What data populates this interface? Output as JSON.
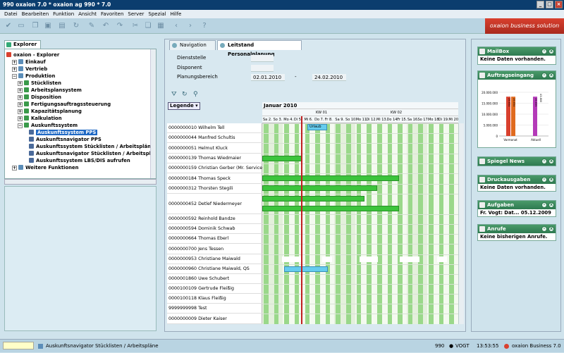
{
  "window": {
    "title": "990 oxaion  7.0 * oxaion ag 990    * 7.0"
  },
  "menu": [
    "Datei",
    "Bearbeiten",
    "Funktion",
    "Ansicht",
    "Favoriten",
    "Server",
    "Spezial",
    "Hilfe"
  ],
  "brand": "oxaion business solution",
  "explorer": {
    "tab": "Explorer",
    "items": [
      {
        "label": "oxaion - Explorer",
        "level": 0
      },
      {
        "label": "Einkauf",
        "level": 1
      },
      {
        "label": "Vertrieb",
        "level": 1
      },
      {
        "label": "Produktion",
        "level": 1
      },
      {
        "label": "Stücklisten",
        "level": 2
      },
      {
        "label": "Arbeitsplansystem",
        "level": 2
      },
      {
        "label": "Disposition",
        "level": 2
      },
      {
        "label": "Fertigungsauftragssteuerung",
        "level": 2
      },
      {
        "label": "Kapazitätsplanung",
        "level": 2
      },
      {
        "label": "Kalkulation",
        "level": 2
      },
      {
        "label": "Auskunftssystem",
        "level": 2
      },
      {
        "label": "Auskunftssystem PPS",
        "level": 3,
        "selected": true
      },
      {
        "label": "Auskunftsnavigator PPS",
        "level": 3
      },
      {
        "label": "Auskunftssystem Stücklisten / Arbeitspläne",
        "level": 3
      },
      {
        "label": "Auskunftsnavigator Stücklisten / Arbeitspläne",
        "level": 3
      },
      {
        "label": "Auskunftssystem LBS/DIS aufrufen",
        "level": 3
      },
      {
        "label": "Weitere Funktionen",
        "level": 1
      }
    ]
  },
  "main": {
    "tabs": [
      {
        "label": "Navigation"
      },
      {
        "label": "Leitstand Personalplanung"
      }
    ],
    "form": {
      "dienststelle_label": "Dienststelle",
      "disponent_label": "Disponent",
      "planungsbereich_label": "Planungsbereich",
      "date_from": "02.01.2010",
      "date_sep": "-",
      "date_to": "24.02.2010"
    },
    "legende": "Legende",
    "month": "Januar 2010",
    "weeks": [
      "KW 01",
      "KW 02"
    ],
    "days": [
      "Sa 2.",
      "So 3.",
      "Mo 4.",
      "Di 5.",
      "Mi 6.",
      "Do 7.",
      "Fr 8.",
      "Sa 9.",
      "So 10.",
      "Mo 11.",
      "Di 12.",
      "Mi 13.",
      "Do 14.",
      "Fr 15.",
      "Sa 16.",
      "So 17.",
      "Mo 18.",
      "Di 19.",
      "Mi 20."
    ],
    "urlaub_label": "Urlaub",
    "persons": [
      {
        "name": "0000000010 Wilhelm Tell"
      },
      {
        "name": "0000000044 Manfred Schultis"
      },
      {
        "name": "0000000051 Helmut Kluck"
      },
      {
        "name": "0000000139 Thomas Wiedmaier"
      },
      {
        "name": "0000000159 Christian Gerber (Mr. Service)"
      },
      {
        "name": "0000000184 Thomas Speck"
      },
      {
        "name": "0000000312 Thorsten Stegili"
      },
      {
        "name": "0000000452 Detlef Niedermeyer"
      },
      {
        "name": "0000000592 Reinhold Bandze"
      },
      {
        "name": "0000000594 Dominik Schwab"
      },
      {
        "name": "0000000664 Thomas Eberl"
      },
      {
        "name": "0000000700 Jens Tessen"
      },
      {
        "name": "0000000953 Christiane Maiwald"
      },
      {
        "name": "0000000960 Christiane Maiwald, QS"
      },
      {
        "name": "0000001860 Uwe Schubert"
      },
      {
        "name": "0000100109 Gertrude Fleißig"
      },
      {
        "name": "0000100118 Klaus Fleißig"
      },
      {
        "name": "9999999998 Test"
      },
      {
        "name": "0000000009 Dieter Kaiser"
      }
    ]
  },
  "widgets": {
    "mailbox": {
      "title": "MailBox",
      "text": "Keine Daten vorhanden."
    },
    "auftragseingang": {
      "title": "Auftragseingang",
      "chart_data": {
        "type": "bar",
        "categories": [
          "Vormonat",
          "Aktuell"
        ],
        "series": [
          {
            "values": [
              29654,
              0
            ]
          },
          {
            "values": [
              29654,
              0
            ]
          },
          {
            "values": [
              0,
              29655
            ]
          },
          {
            "values": [
              0,
              43800
            ]
          }
        ],
        "value_labels": [
          "29.654",
          "29.654",
          "29.655",
          "43.800"
        ],
        "yticks": [
          "20.000.000",
          "15.000.000",
          "10.000.000",
          "5.000.000",
          "0"
        ],
        "ylim": [
          0,
          20000000
        ]
      }
    },
    "spiegel": {
      "title": "Spiegel News"
    },
    "druckausgaben": {
      "title": "Druckausgaben",
      "text": "Keine Daten vorhanden."
    },
    "aufgaben": {
      "title": "Aufgaben",
      "text": "Fr. Vogt: Dat...  05.12.2009"
    },
    "anrufe": {
      "title": "Anrufe",
      "text": "Keine bisherigen Anrufe."
    }
  },
  "status": {
    "path": "Auskunftsnavigator Stücklisten / Arbeitspläne",
    "num": "990",
    "user": "VOGT",
    "time": "13:53:55",
    "product": "oxaion Business 7.0"
  },
  "colors": {
    "accent": "#0b3d6e",
    "brand": "#c83a28",
    "bar_green": "#3cc43c",
    "bar_blue": "#66ccee"
  }
}
